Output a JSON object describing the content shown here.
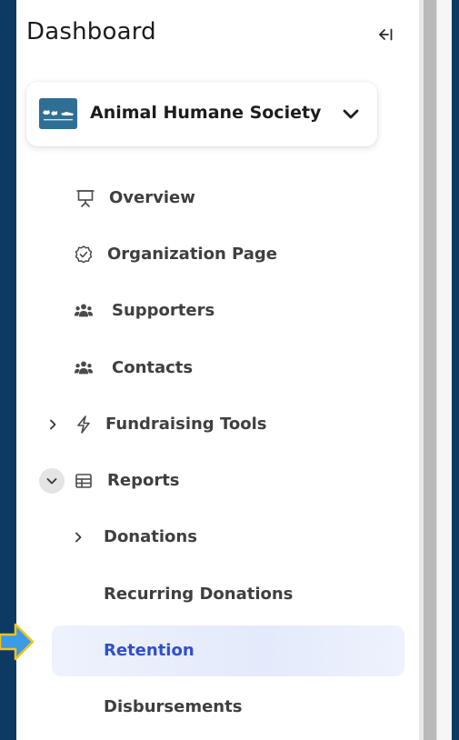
{
  "sidebar": {
    "title": "Dashboard",
    "org": {
      "name": "Animal Humane Society"
    },
    "items": [
      {
        "label": "Overview",
        "icon": "presentation-icon"
      },
      {
        "label": "Organization Page",
        "icon": "verified-check-icon"
      },
      {
        "label": "Supporters",
        "icon": "people-icon"
      },
      {
        "label": "Contacts",
        "icon": "people-icon"
      },
      {
        "label": "Fundraising Tools",
        "icon": "lightning-icon",
        "expanded": false
      },
      {
        "label": "Reports",
        "icon": "table-icon",
        "expanded": true
      }
    ],
    "report_items": [
      {
        "label": "Donations",
        "expanded": false
      },
      {
        "label": "Recurring Donations"
      },
      {
        "label": "Retention",
        "selected": true
      },
      {
        "label": "Disbursements"
      }
    ]
  },
  "colors": {
    "frame": "#0d3a63",
    "selected_text": "#2f4fd0",
    "selected_bg": "#eef2fd",
    "pointer": "#3b9be6",
    "pointer_outline": "#f2c21b"
  }
}
